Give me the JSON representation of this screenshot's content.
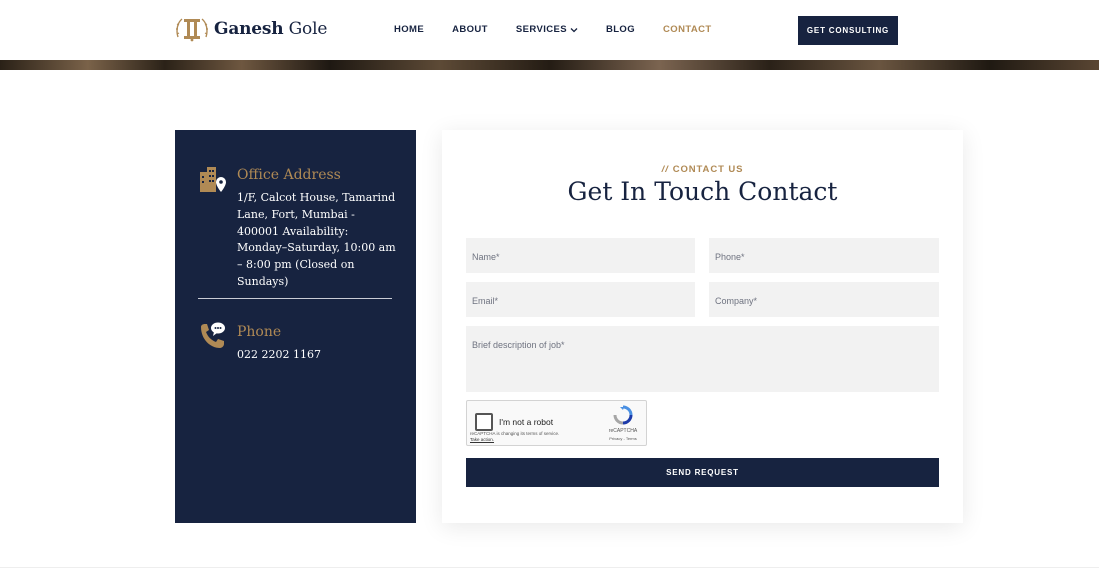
{
  "brand": {
    "name_first": "Ganesh",
    "name_last": "Gole"
  },
  "nav": {
    "items": [
      {
        "label": "HOME"
      },
      {
        "label": "ABOUT"
      },
      {
        "label": "SERVICES"
      },
      {
        "label": "BLOG"
      },
      {
        "label": "CONTACT"
      }
    ],
    "active": "CONTACT",
    "cta_label": "GET CONSULTING"
  },
  "info": {
    "office": {
      "title": "Office Address",
      "text": "1/F, Calcot House, Tamarind Lane, Fort, Mumbai - 400001 Availability: Monday–Saturday, 10:00 am – 8:00 pm (Closed on Sundays)"
    },
    "phone": {
      "title": "Phone",
      "text": "022 2202 1167"
    }
  },
  "form": {
    "eyebrow_slashes": "//",
    "eyebrow": "CONTACT US",
    "title": "Get In Touch Contact",
    "fields": {
      "name_placeholder": "Name*",
      "phone_placeholder": "Phone*",
      "email_placeholder": "Email*",
      "company_placeholder": "Company*",
      "description_placeholder": "Brief description of job*"
    },
    "captcha": {
      "label": "I'm not a robot",
      "notice": "reCAPTCHA is changing its terms of service.",
      "notice_link": "Take action.",
      "brand": "reCAPTCHA",
      "privacy": "Privacy - Terms"
    },
    "submit_label": "SEND REQUEST"
  },
  "colors": {
    "navy": "#172340",
    "gold": "#b08a55",
    "field_bg": "#f2f2f2"
  }
}
